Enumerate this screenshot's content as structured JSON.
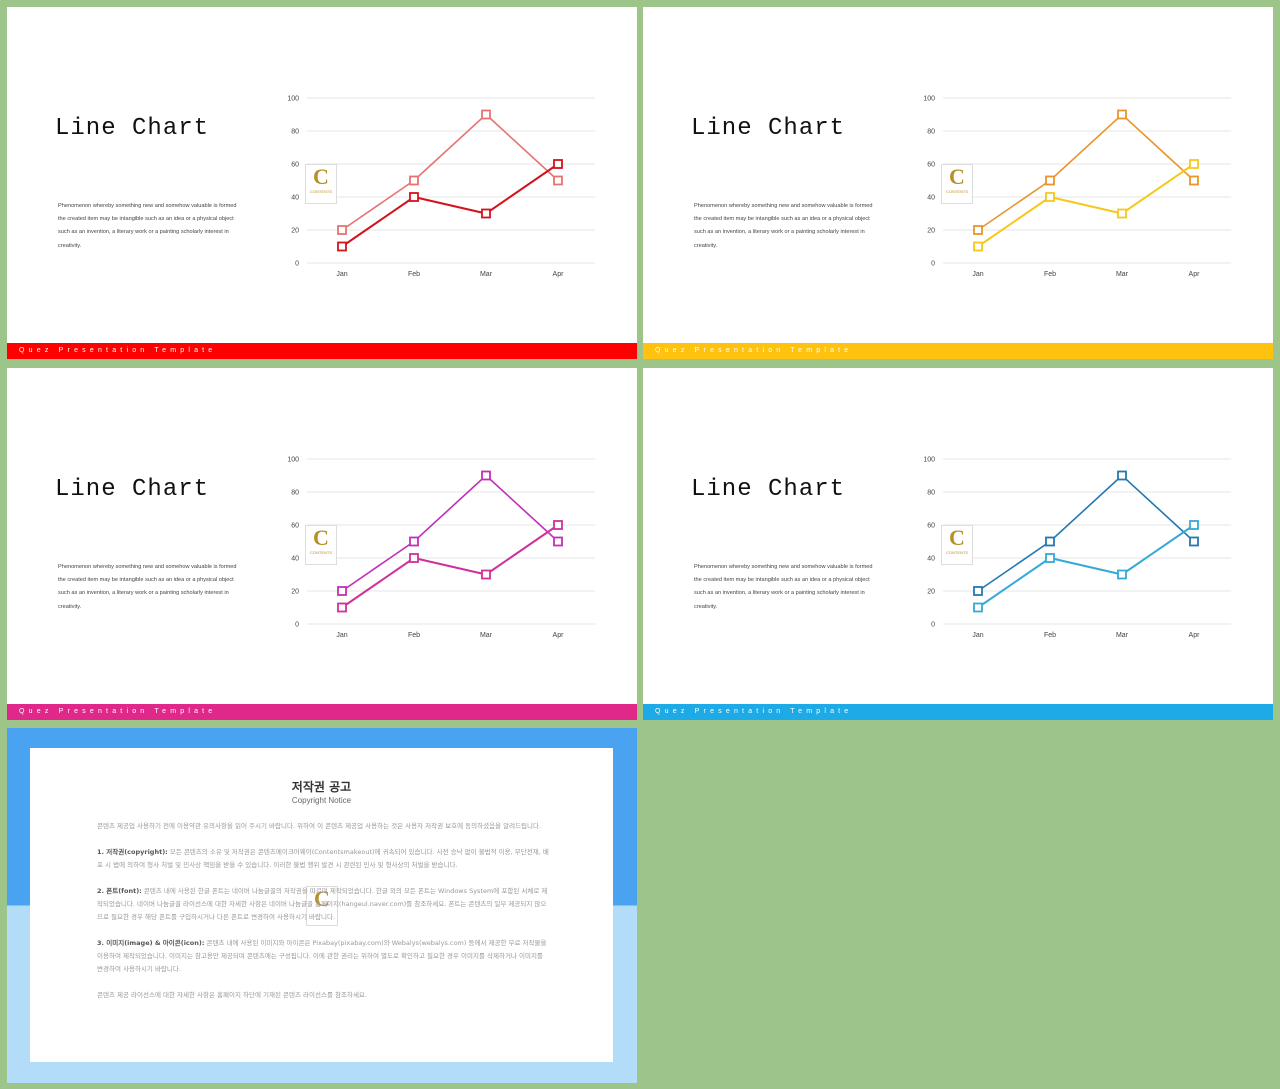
{
  "slides": [
    {
      "title": "Line Chart",
      "paragraph": "Phenomenon whereby something new and somehow valuable is formed the created item may be intangible such as an idea or a physical object such as an invention, a literary work or a painting scholarly interest in creativity.",
      "footer": "Quez Presentation Template",
      "colors": {
        "footer": "#ff0000",
        "series": [
          "#e87272",
          "#d3121c"
        ]
      }
    },
    {
      "title": "Line Chart",
      "paragraph": "Phenomenon whereby something new and somehow valuable is formed the created item may be intangible such as an idea or a physical object such as an invention, a literary work or a painting scholarly interest in creativity.",
      "footer": "Quez Presentation Template",
      "colors": {
        "footer": "#ffc20e",
        "series": [
          "#e8952c",
          "#f6c81c"
        ]
      }
    },
    {
      "title": "Line Chart",
      "paragraph": "Phenomenon whereby something new and somehow valuable is formed the created item may be intangible such as an idea or a physical object such as an invention, a literary work or a painting scholarly interest in creativity.",
      "footer": "Quez Presentation Template",
      "colors": {
        "footer": "#e0288a",
        "series": [
          "#c030b8",
          "#d0309a"
        ]
      }
    },
    {
      "title": "Line Chart",
      "paragraph": "Phenomenon whereby something new and somehow valuable is formed the created item may be intangible such as an idea or a physical object such as an invention, a literary work or a painting scholarly interest in creativity.",
      "footer": "Quez Presentation Template",
      "colors": {
        "footer": "#1eaae6",
        "series": [
          "#2478b0",
          "#34aad8"
        ]
      }
    }
  ],
  "logo": {
    "letter": "C",
    "text": "CONTENTS"
  },
  "chart_data": [
    {
      "type": "line",
      "categories": [
        "Jan",
        "Feb",
        "Mar",
        "Apr"
      ],
      "series": [
        {
          "values": [
            20,
            50,
            90,
            50
          ]
        },
        {
          "values": [
            10,
            40,
            30,
            60
          ]
        }
      ],
      "ylim": [
        0,
        100
      ],
      "yticks": [
        0,
        20,
        40,
        60,
        80,
        100
      ],
      "grid": true,
      "marker": "square"
    },
    {
      "type": "line",
      "categories": [
        "Jan",
        "Feb",
        "Mar",
        "Apr"
      ],
      "series": [
        {
          "values": [
            20,
            50,
            90,
            50
          ]
        },
        {
          "values": [
            10,
            40,
            30,
            60
          ]
        }
      ],
      "ylim": [
        0,
        100
      ],
      "yticks": [
        0,
        20,
        40,
        60,
        80,
        100
      ],
      "grid": true,
      "marker": "square"
    },
    {
      "type": "line",
      "categories": [
        "Jan",
        "Feb",
        "Mar",
        "Apr"
      ],
      "series": [
        {
          "values": [
            20,
            50,
            90,
            50
          ]
        },
        {
          "values": [
            10,
            40,
            30,
            60
          ]
        }
      ],
      "ylim": [
        0,
        100
      ],
      "yticks": [
        0,
        20,
        40,
        60,
        80,
        100
      ],
      "grid": true,
      "marker": "square"
    },
    {
      "type": "line",
      "categories": [
        "Jan",
        "Feb",
        "Mar",
        "Apr"
      ],
      "series": [
        {
          "values": [
            20,
            50,
            90,
            50
          ]
        },
        {
          "values": [
            10,
            40,
            30,
            60
          ]
        }
      ],
      "ylim": [
        0,
        100
      ],
      "yticks": [
        0,
        20,
        40,
        60,
        80,
        100
      ],
      "grid": true,
      "marker": "square"
    }
  ],
  "copyright": {
    "title": "저작권 공고",
    "subtitle": "Copyright Notice",
    "intro": "콘텐츠 제공업 사용하기 전에 이용약관 유의사항을 읽어 주시기 바랍니다. 위하여 이 콘텐츠 제공업 사용하는 것은 사용자 저작권 보호에 동의하셨음을 알려드립니다.",
    "items": [
      {
        "label": "1. 저작권(copyright):",
        "text": "모든 콘텐츠의 소유 및 저작권은 콘텐츠메이크어웨이(Contentsmakeout)에 귀속되어 있습니다. 사전 승낙 없이 불법적 이용, 무단전재, 배포 시 법에 의하여 형사 처벌 및 민사상 책임을 받을 수 있습니다. 이러한 불법 행위 발견 시 관련된 민사 및 형사상의 처벌을 받습니다."
      },
      {
        "label": "2. 폰트(font):",
        "text": "콘텐츠 내에 사용된 한글 폰트는 네이버 나눔글꼴의 저작권을 따르며 제작되었습니다. 한글 외의 모든 폰트는 Windows System에 포함된 서체로 제작되었습니다. 네이버 나눔글꼴 라이선스에 대한 자세한 사항은 네이버 나눔글꼴 홈페이지(hangeul.naver.com)를 참조하세요. 폰트는 콘텐츠의 일부 제공되지 않으므로 필요한 경우 해당 폰트를 구입하시거나 다른 폰트로 변경하여 사용하시기 바랍니다."
      },
      {
        "label": "3. 이미지(image) & 아이콘(icon):",
        "text": "콘텐츠 내에 사용된 이미지와 아이콘은 Pixabay(pixabay.com)와 Webalys(webalys.com) 등에서 제공한 무료 저작물을 이용하여 제작되었습니다. 이미지는 참고용만 제공되며 콘텐츠에는 구성됩니다. 이에 관한 권리는 위하여 별도로 확인하고 필요한 경우 이미지를 삭제하거나 이미지를 변경하여 사용하시기 바랍니다."
      }
    ],
    "closing": "콘텐츠 제공 라이선스에 대한 자세한 사항은 홈페이지 하단에 기재된 콘텐츠 라이선스를 참조하세요."
  }
}
